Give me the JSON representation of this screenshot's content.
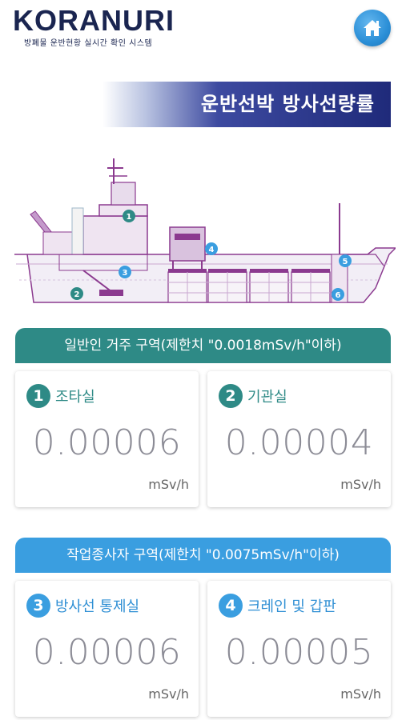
{
  "header": {
    "logo_title": "KORANURI",
    "logo_subtitle": "방폐물 운반현황 실시간 확인 시스템",
    "home_icon": "home-icon"
  },
  "banner": {
    "title": "운반선박 방사선량률"
  },
  "ship": {
    "markers": [
      "1",
      "2",
      "3",
      "4",
      "5",
      "6"
    ]
  },
  "colors": {
    "teal": "#2e8a86",
    "blue": "#3a9ee0",
    "navy": "#1f2a7a"
  },
  "zones": [
    {
      "header": "일반인 거주 구역(제한치 \"0.0018mSv/h\"이하)",
      "cards": [
        {
          "num": "1",
          "label": "조타실",
          "value": "0.00006",
          "unit": "mSv/h"
        },
        {
          "num": "2",
          "label": "기관실",
          "value": "0.00004",
          "unit": "mSv/h"
        }
      ]
    },
    {
      "header": "작업종사자 구역(제한치 \"0.0075mSv/h\"이하)",
      "cards": [
        {
          "num": "3",
          "label": "방사선 통제실",
          "value": "0.00006",
          "unit": "mSv/h"
        },
        {
          "num": "4",
          "label": "크레인 및 갑판",
          "value": "0.00005",
          "unit": "mSv/h"
        }
      ]
    }
  ]
}
